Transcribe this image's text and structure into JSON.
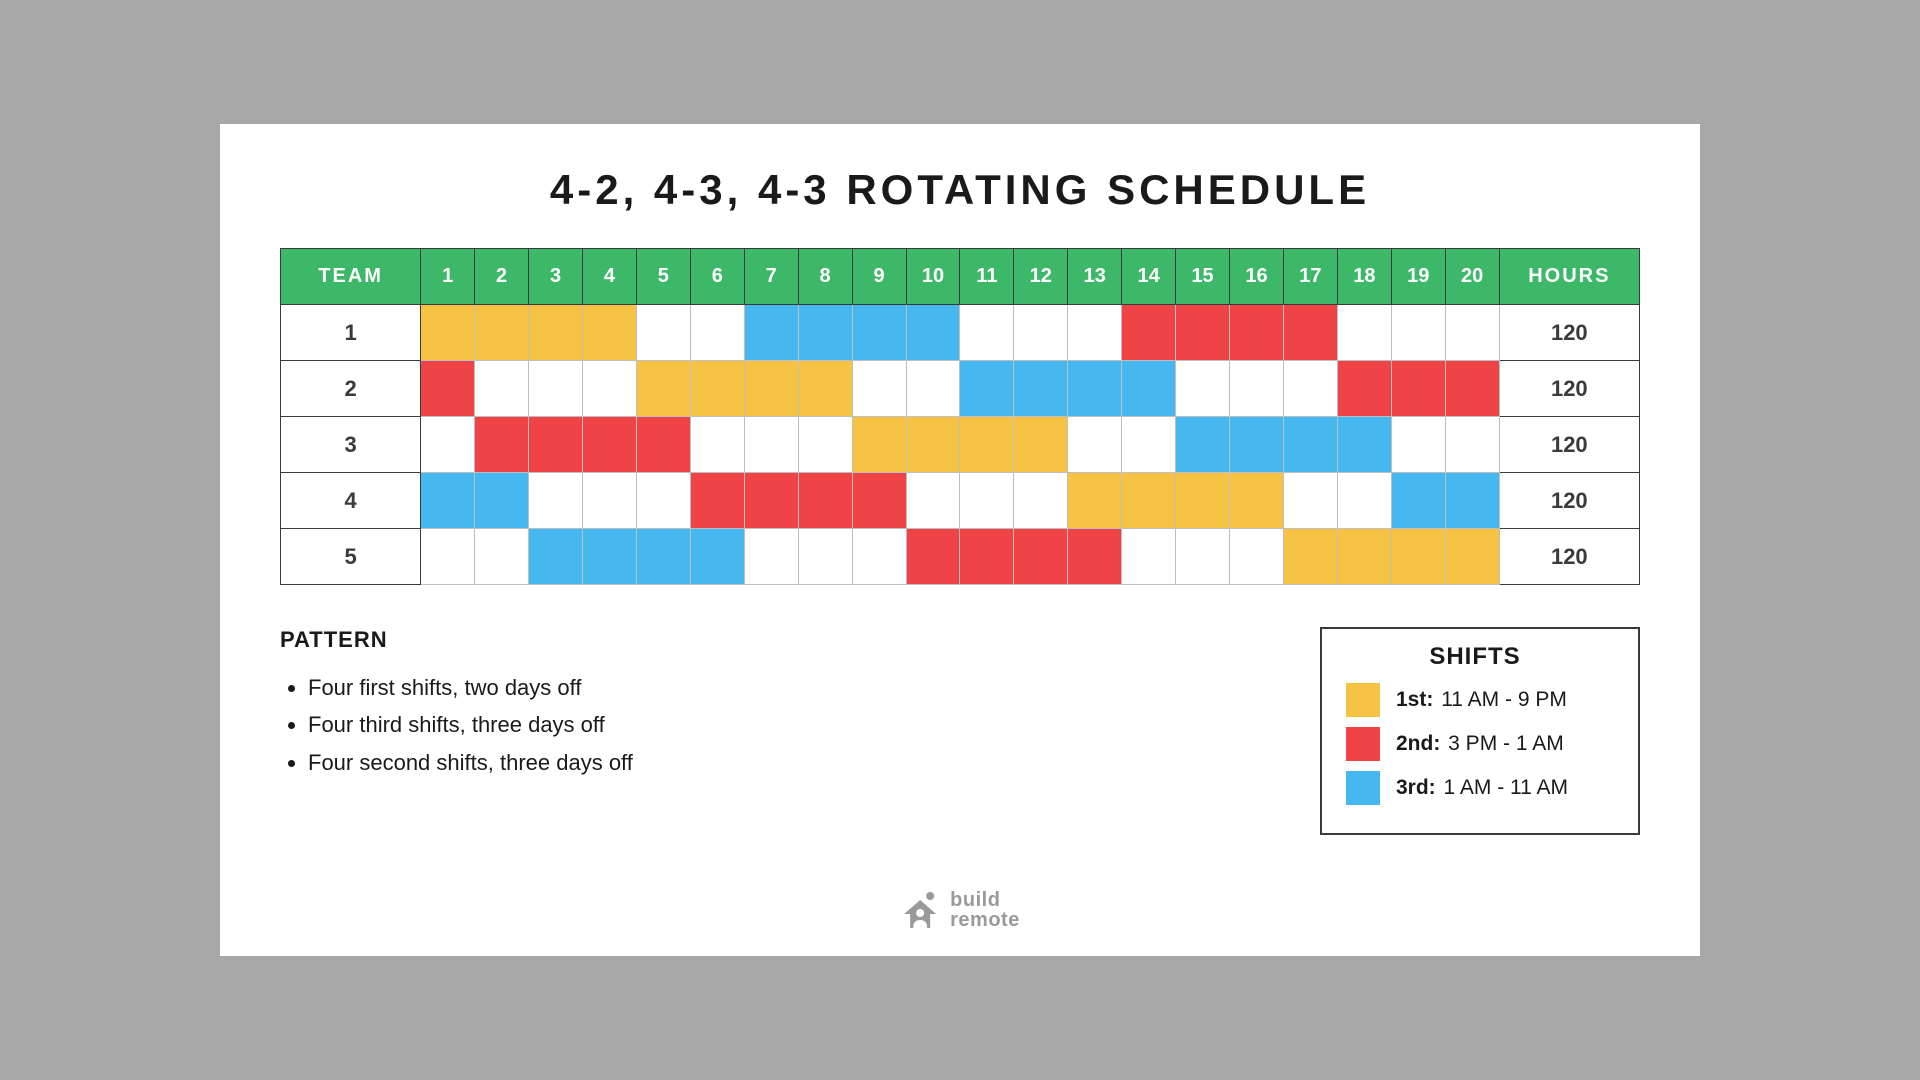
{
  "title": "4-2, 4-3, 4-3 ROTATING SCHEDULE",
  "headers": {
    "team": "TEAM",
    "hours": "HOURS"
  },
  "days": [
    "1",
    "2",
    "3",
    "4",
    "5",
    "6",
    "7",
    "8",
    "9",
    "10",
    "11",
    "12",
    "13",
    "14",
    "15",
    "16",
    "17",
    "18",
    "19",
    "20"
  ],
  "colors": {
    "first": "#f6c244",
    "second": "#ef4447",
    "third": "#47b7ef",
    "off": "#ffffff",
    "header": "#3cb868"
  },
  "teams": [
    {
      "name": "1",
      "hours": "120",
      "cells": [
        "first",
        "first",
        "first",
        "first",
        "off",
        "off",
        "third",
        "third",
        "third",
        "third",
        "off",
        "off",
        "off",
        "second",
        "second",
        "second",
        "second",
        "off",
        "off",
        "off"
      ]
    },
    {
      "name": "2",
      "hours": "120",
      "cells": [
        "second",
        "off",
        "off",
        "off",
        "first",
        "first",
        "first",
        "first",
        "off",
        "off",
        "third",
        "third",
        "third",
        "third",
        "off",
        "off",
        "off",
        "second",
        "second",
        "second"
      ]
    },
    {
      "name": "3",
      "hours": "120",
      "cells": [
        "off",
        "second",
        "second",
        "second",
        "second",
        "off",
        "off",
        "off",
        "first",
        "first",
        "first",
        "first",
        "off",
        "off",
        "third",
        "third",
        "third",
        "third",
        "off",
        "off"
      ]
    },
    {
      "name": "4",
      "hours": "120",
      "cells": [
        "third",
        "third",
        "off",
        "off",
        "off",
        "second",
        "second",
        "second",
        "second",
        "off",
        "off",
        "off",
        "first",
        "first",
        "first",
        "first",
        "off",
        "off",
        "third",
        "third"
      ]
    },
    {
      "name": "5",
      "hours": "120",
      "cells": [
        "off",
        "off",
        "third",
        "third",
        "third",
        "third",
        "off",
        "off",
        "off",
        "second",
        "second",
        "second",
        "second",
        "off",
        "off",
        "off",
        "first",
        "first",
        "first",
        "first"
      ]
    }
  ],
  "pattern": {
    "heading": "PATTERN",
    "items": [
      "Four first shifts, two days off",
      "Four third shifts, three days off",
      "Four second shifts, three days off"
    ]
  },
  "legend": {
    "heading": "SHIFTS",
    "items": [
      {
        "key": "first",
        "label": "1st:",
        "times": "11 AM - 9 PM"
      },
      {
        "key": "second",
        "label": "2nd:",
        "times": "3 PM - 1 AM"
      },
      {
        "key": "third",
        "label": "3rd:",
        "times": "1 AM - 11 AM"
      }
    ]
  },
  "brand": {
    "line1": "build",
    "line2": "remote"
  }
}
